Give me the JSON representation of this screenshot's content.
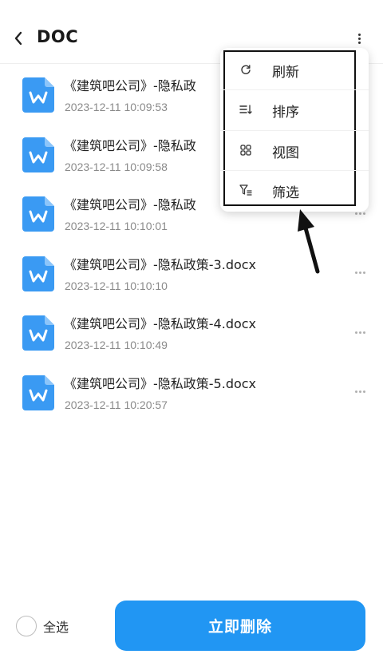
{
  "header": {
    "title": "DOC",
    "back_icon": "chevron-left-icon",
    "more_icon": "more-vertical-icon"
  },
  "files": [
    {
      "name": "《建筑吧公司》-隐私政",
      "date": "2023-12-11 10:09:53"
    },
    {
      "name": "《建筑吧公司》-隐私政",
      "date": "2023-12-11 10:09:58"
    },
    {
      "name": "《建筑吧公司》-隐私政",
      "date": "2023-12-11 10:10:01"
    },
    {
      "name": "《建筑吧公司》-隐私政策-3.docx",
      "date": "2023-12-11 10:10:10"
    },
    {
      "name": "《建筑吧公司》-隐私政策-4.docx",
      "date": "2023-12-11 10:10:49"
    },
    {
      "name": "《建筑吧公司》-隐私政策-5.docx",
      "date": "2023-12-11 10:20:57"
    }
  ],
  "menu": {
    "items": [
      {
        "label": "刷新",
        "icon": "refresh-icon"
      },
      {
        "label": "排序",
        "icon": "sort-icon"
      },
      {
        "label": "视图",
        "icon": "grid-view-icon"
      },
      {
        "label": "筛选",
        "icon": "filter-icon"
      }
    ]
  },
  "footer": {
    "select_all_label": "全选",
    "delete_label": "立即删除"
  },
  "colors": {
    "accent": "#2196f3",
    "word_icon": "#3a9af3"
  }
}
